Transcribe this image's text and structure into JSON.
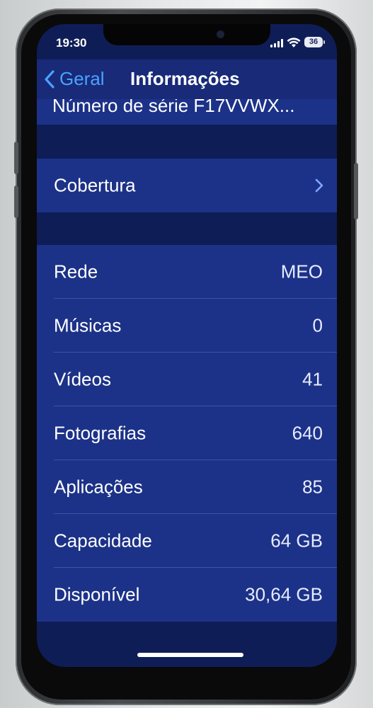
{
  "status_bar": {
    "time": "19:30",
    "battery": "36"
  },
  "nav": {
    "back_label": "Geral",
    "title": "Informações"
  },
  "partial_row": {
    "label": "Número de série F17VVWX..."
  },
  "coverage": {
    "label": "Cobertura"
  },
  "info_rows": [
    {
      "label": "Rede",
      "value": "MEO"
    },
    {
      "label": "Músicas",
      "value": "0"
    },
    {
      "label": "Vídeos",
      "value": "41"
    },
    {
      "label": "Fotografias",
      "value": "640"
    },
    {
      "label": "Aplicações",
      "value": "85"
    },
    {
      "label": "Capacidade",
      "value": "64 GB"
    },
    {
      "label": "Disponível",
      "value": "30,64 GB"
    }
  ],
  "colors": {
    "accent": "#4aa2ff",
    "row_background": "#1c3288",
    "screen_background": "#0f1d57"
  }
}
